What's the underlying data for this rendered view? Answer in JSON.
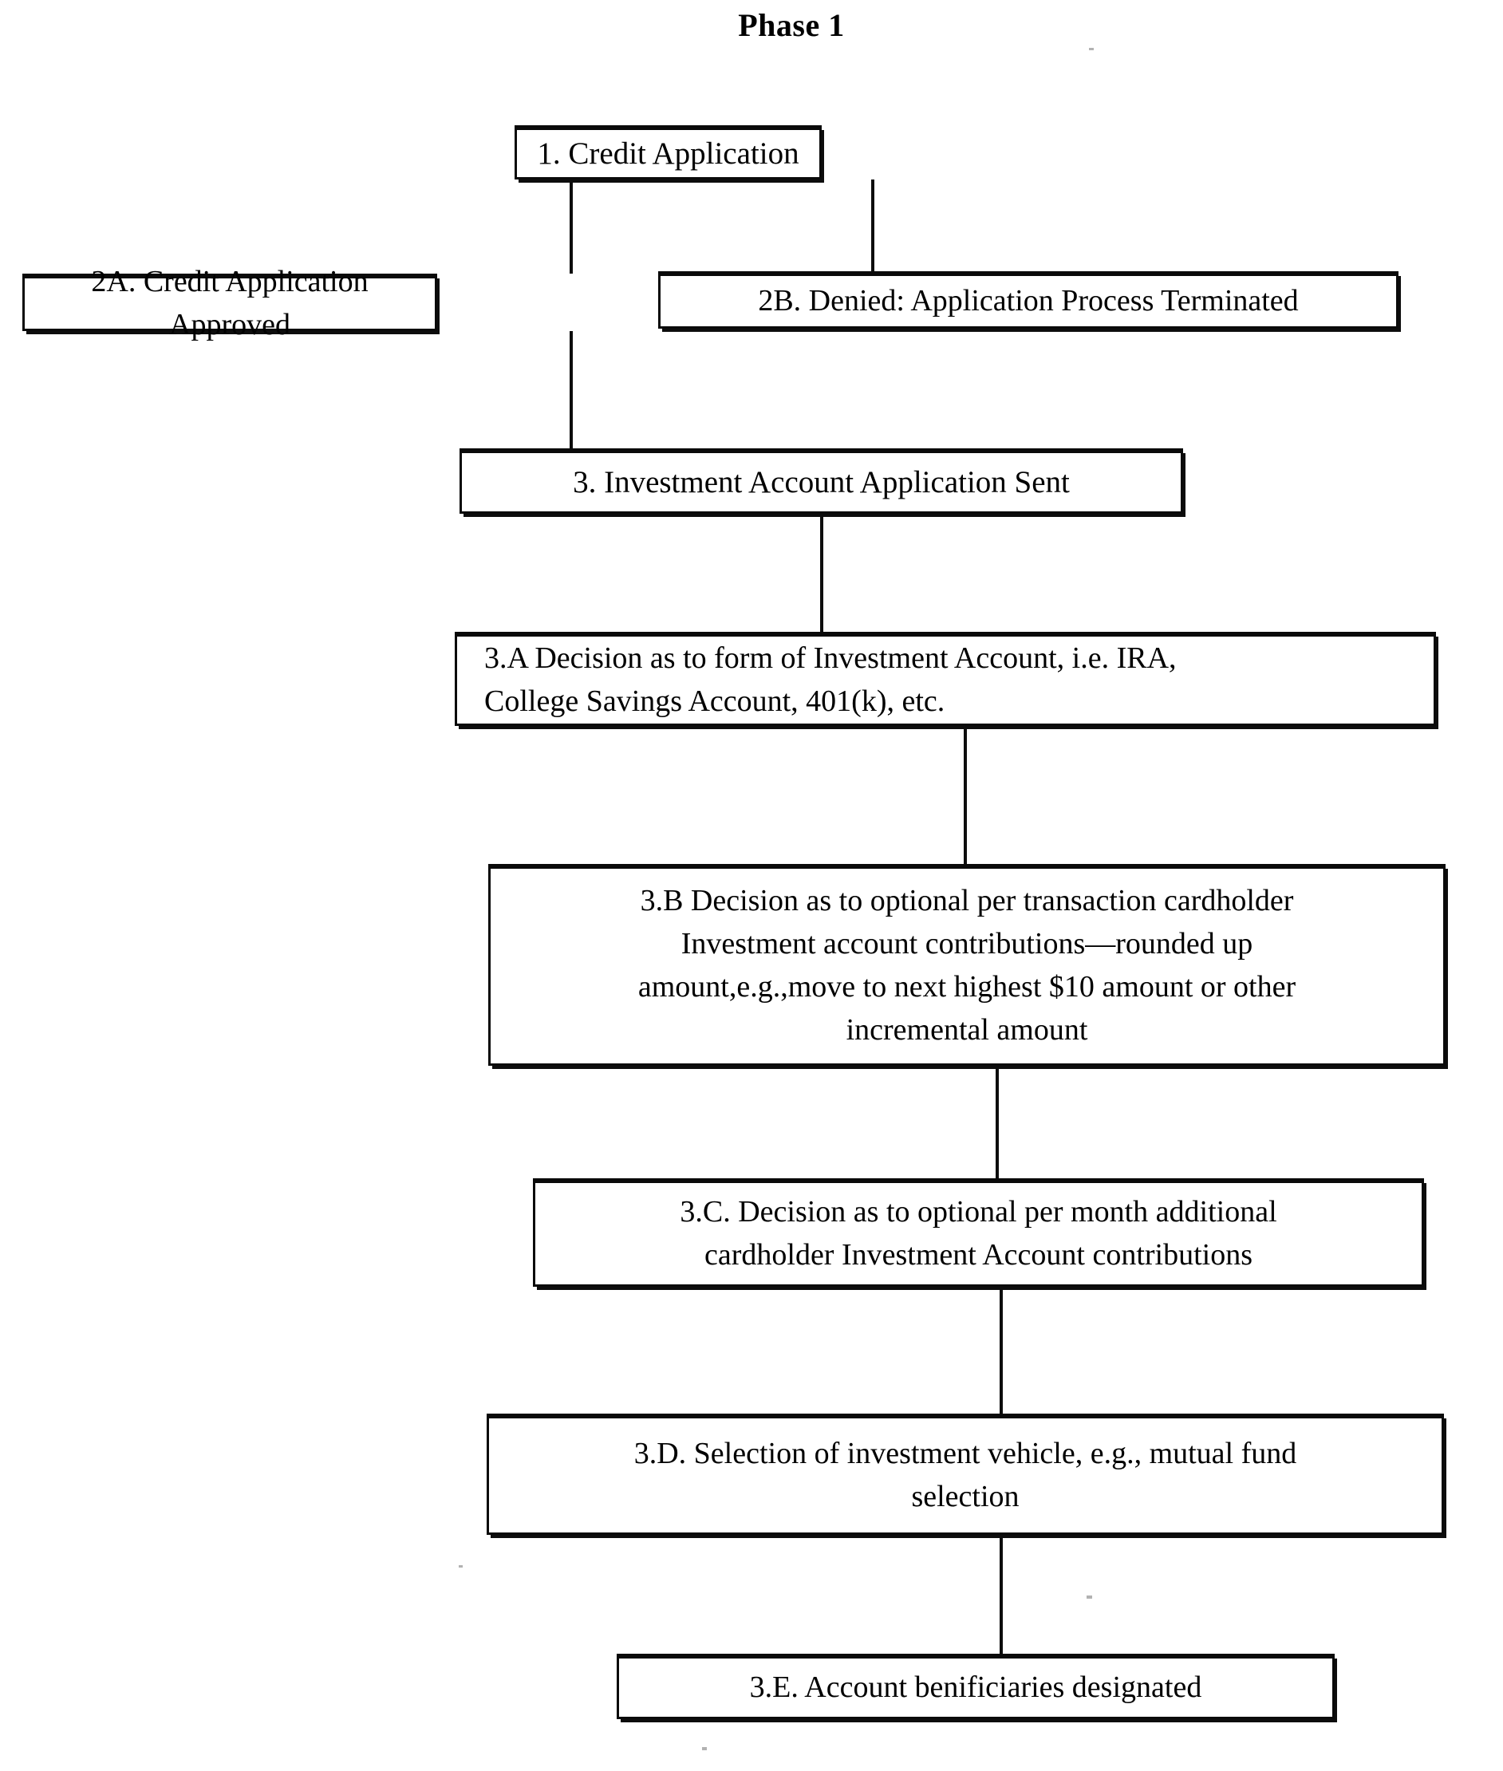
{
  "title": "Phase 1",
  "diagram": {
    "type": "flowchart",
    "orientation": "top-to-bottom",
    "nodes": [
      {
        "id": "1",
        "label": "1.   Credit Application"
      },
      {
        "id": "2A",
        "label": "2A. Credit Application Approved"
      },
      {
        "id": "2B",
        "label": "2B. Denied: Application Process Terminated"
      },
      {
        "id": "3",
        "label": "3.   Investment Account Application Sent"
      },
      {
        "id": "3A",
        "label": "3.A Decision as to form of Investment Account, i.e. IRA,\nCollege Savings Account, 401(k), etc."
      },
      {
        "id": "3B",
        "label": "3.B Decision as to optional per transaction cardholder\nInvestment account contributions—rounded up\namount,e.g.,move to next highest $10 amount or other\nincremental amount"
      },
      {
        "id": "3C",
        "label": "3.C.  Decision as to optional per month additional\ncardholder Investment Account contributions"
      },
      {
        "id": "3D",
        "label": "3.D. Selection of investment vehicle, e.g., mutual fund\nselection"
      },
      {
        "id": "3E",
        "label": "3.E.  Account benificiaries designated"
      }
    ],
    "edges": [
      {
        "from": "1",
        "to": "2A"
      },
      {
        "from": "1",
        "to": "2B"
      },
      {
        "from": "2A",
        "to": "3"
      },
      {
        "from": "3",
        "to": "3A"
      },
      {
        "from": "3A",
        "to": "3B"
      },
      {
        "from": "3B",
        "to": "3C"
      },
      {
        "from": "3C",
        "to": "3D"
      },
      {
        "from": "3D",
        "to": "3E"
      }
    ],
    "colors": {
      "stroke": "#0d0d0d",
      "fill": "#ffffff",
      "text": "#000000"
    }
  }
}
